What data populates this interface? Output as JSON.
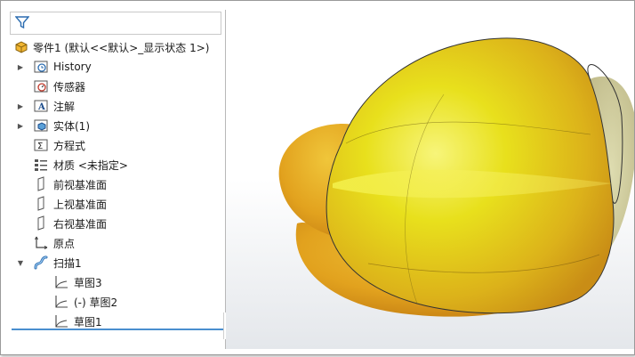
{
  "tree": {
    "root": {
      "label": "零件1 (默认<<默认>_显示状态 1>)",
      "icon": "part-icon"
    },
    "items": [
      {
        "label": "History",
        "icon": "history-folder-icon",
        "expandable": true,
        "expanded": false
      },
      {
        "label": "传感器",
        "icon": "sensors-folder-icon",
        "expandable": false
      },
      {
        "label": "注解",
        "icon": "annotations-folder-icon",
        "expandable": true,
        "expanded": false
      },
      {
        "label": "实体(1)",
        "icon": "solid-bodies-folder-icon",
        "expandable": true,
        "expanded": false
      },
      {
        "label": "方程式",
        "icon": "equations-icon",
        "expandable": false
      },
      {
        "label": "材质 <未指定>",
        "icon": "material-icon",
        "expandable": false
      },
      {
        "label": "前视基准面",
        "icon": "plane-icon",
        "expandable": false
      },
      {
        "label": "上视基准面",
        "icon": "plane-icon",
        "expandable": false
      },
      {
        "label": "右视基准面",
        "icon": "plane-icon",
        "expandable": false
      },
      {
        "label": "原点",
        "icon": "origin-icon",
        "expandable": false
      },
      {
        "label": "扫描1",
        "icon": "sweep-icon",
        "expandable": true,
        "expanded": true
      }
    ],
    "children": [
      {
        "label": "草图3",
        "icon": "sketch-icon"
      },
      {
        "label": "(-) 草图2",
        "icon": "sketch-icon"
      },
      {
        "label": "草图1",
        "icon": "sketch-icon"
      }
    ]
  },
  "colors": {
    "accent": "#4a8fcf",
    "model_yellow": "#e8dc1a",
    "model_orange": "#e0a81c"
  }
}
